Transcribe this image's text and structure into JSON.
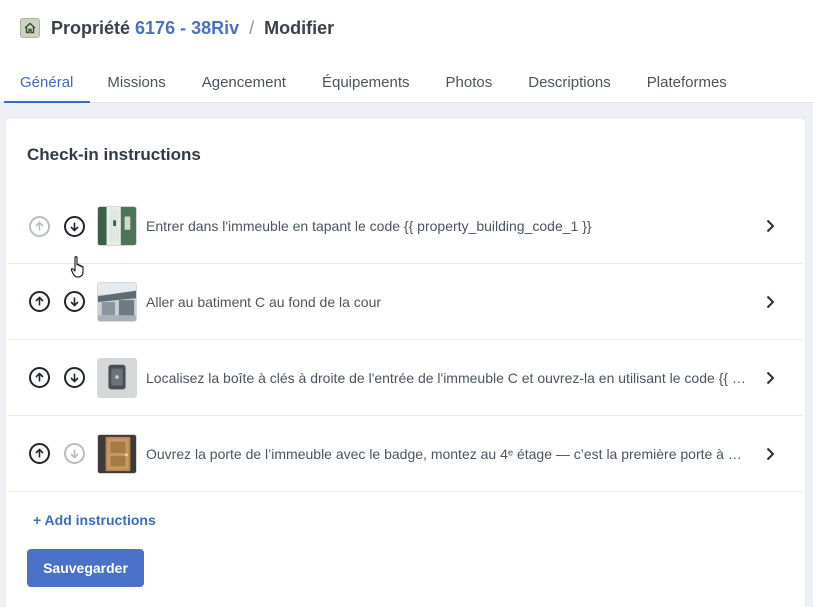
{
  "header": {
    "icon": "home-icon",
    "title_prefix": "Propriété",
    "property_ref": "6176 - 38Riv",
    "separator": "/",
    "action": "Modifier"
  },
  "tabs": [
    {
      "label": "Général",
      "active": true
    },
    {
      "label": "Missions"
    },
    {
      "label": "Agencement"
    },
    {
      "label": "Équipements"
    },
    {
      "label": "Photos"
    },
    {
      "label": "Descriptions"
    },
    {
      "label": "Plateformes"
    }
  ],
  "section": {
    "title": "Check-in instructions",
    "instructions": [
      {
        "text": "Entrer dans l'immeuble en tapant le code {{ property_building_code_1 }}",
        "up_enabled": false,
        "down_enabled": true,
        "thumb": "building-door"
      },
      {
        "text": "Aller au batiment C au fond de la cour",
        "up_enabled": true,
        "down_enabled": true,
        "thumb": "courtyard"
      },
      {
        "text": "Localisez la boîte à clés à droite de l'entrée de l'immeuble C et ouvrez-la en utilisant le code {{ property_keybox_code }}",
        "up_enabled": true,
        "down_enabled": true,
        "thumb": "key-box"
      },
      {
        "text": "Ouvrez la porte de l’immeuble avec le badge, montez au 4ᵉ étage — c’est la première porte à droite",
        "up_enabled": true,
        "down_enabled": false,
        "thumb": "wooden-door"
      }
    ],
    "add_label": "+ Add instructions",
    "save_label": "Sauvegarder"
  },
  "colors": {
    "accent": "#3c6bc5",
    "button": "#4a72c8",
    "background": "#eef0f5"
  }
}
